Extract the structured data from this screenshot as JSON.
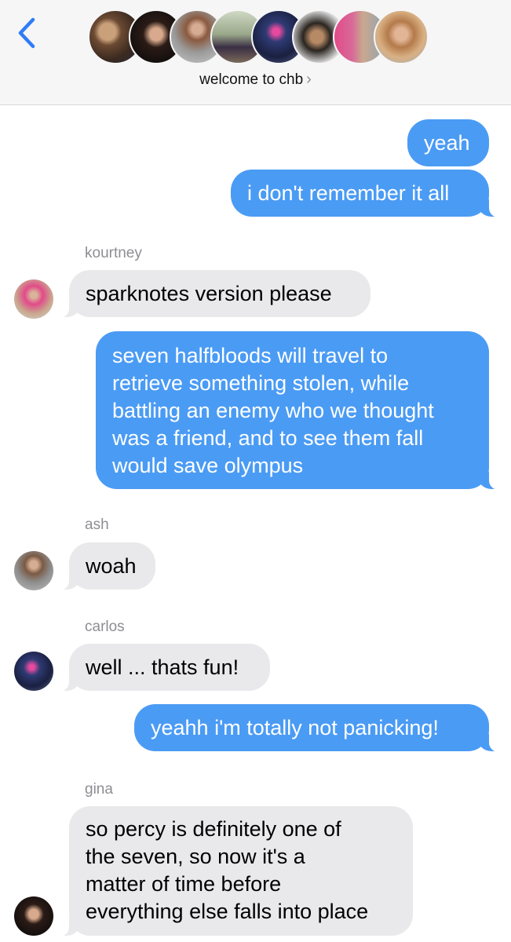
{
  "header": {
    "group_name": "welcome to chb",
    "chevron": "›",
    "back_icon": "chevron-left-icon",
    "participant_avatars": 8
  },
  "colors": {
    "sent_bubble": "#4a9bf4",
    "received_bubble": "#e9e9eb",
    "accent": "#2f7cf6",
    "sender_label": "#8e8e93"
  },
  "messages": [
    {
      "type": "sent",
      "text": "yeah"
    },
    {
      "type": "sent",
      "text": "i don't remember it all"
    },
    {
      "type": "received",
      "sender": "kourtney",
      "text": "sparknotes version please"
    },
    {
      "type": "sent",
      "lines": [
        "seven halfbloods will travel to",
        "retrieve something stolen, while",
        "battling an enemy who we thought",
        "was a friend, and to see them fall",
        "would save olympus"
      ]
    },
    {
      "type": "received",
      "sender": "ash",
      "text": "woah"
    },
    {
      "type": "received",
      "sender": "carlos",
      "text": "well ... thats fun!"
    },
    {
      "type": "sent",
      "text": "yeahh i'm totally not panicking!"
    },
    {
      "type": "received",
      "sender": "gina",
      "lines": [
        "so percy is definitely one of",
        "the seven, so now it's a",
        "matter of time before",
        "everything else falls into place"
      ]
    }
  ]
}
